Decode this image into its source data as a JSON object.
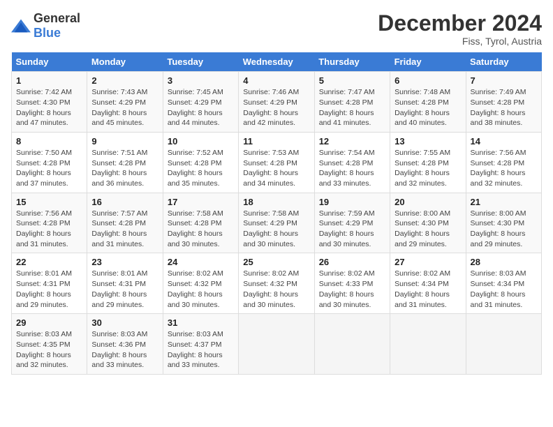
{
  "header": {
    "logo_general": "General",
    "logo_blue": "Blue",
    "title": "December 2024",
    "subtitle": "Fiss, Tyrol, Austria"
  },
  "days_of_week": [
    "Sunday",
    "Monday",
    "Tuesday",
    "Wednesday",
    "Thursday",
    "Friday",
    "Saturday"
  ],
  "weeks": [
    [
      {
        "day": "1",
        "sunrise": "7:42 AM",
        "sunset": "4:30 PM",
        "daylight": "8 hours and 47 minutes."
      },
      {
        "day": "2",
        "sunrise": "7:43 AM",
        "sunset": "4:29 PM",
        "daylight": "8 hours and 45 minutes."
      },
      {
        "day": "3",
        "sunrise": "7:45 AM",
        "sunset": "4:29 PM",
        "daylight": "8 hours and 44 minutes."
      },
      {
        "day": "4",
        "sunrise": "7:46 AM",
        "sunset": "4:29 PM",
        "daylight": "8 hours and 42 minutes."
      },
      {
        "day": "5",
        "sunrise": "7:47 AM",
        "sunset": "4:28 PM",
        "daylight": "8 hours and 41 minutes."
      },
      {
        "day": "6",
        "sunrise": "7:48 AM",
        "sunset": "4:28 PM",
        "daylight": "8 hours and 40 minutes."
      },
      {
        "day": "7",
        "sunrise": "7:49 AM",
        "sunset": "4:28 PM",
        "daylight": "8 hours and 38 minutes."
      }
    ],
    [
      {
        "day": "8",
        "sunrise": "7:50 AM",
        "sunset": "4:28 PM",
        "daylight": "8 hours and 37 minutes."
      },
      {
        "day": "9",
        "sunrise": "7:51 AM",
        "sunset": "4:28 PM",
        "daylight": "8 hours and 36 minutes."
      },
      {
        "day": "10",
        "sunrise": "7:52 AM",
        "sunset": "4:28 PM",
        "daylight": "8 hours and 35 minutes."
      },
      {
        "day": "11",
        "sunrise": "7:53 AM",
        "sunset": "4:28 PM",
        "daylight": "8 hours and 34 minutes."
      },
      {
        "day": "12",
        "sunrise": "7:54 AM",
        "sunset": "4:28 PM",
        "daylight": "8 hours and 33 minutes."
      },
      {
        "day": "13",
        "sunrise": "7:55 AM",
        "sunset": "4:28 PM",
        "daylight": "8 hours and 32 minutes."
      },
      {
        "day": "14",
        "sunrise": "7:56 AM",
        "sunset": "4:28 PM",
        "daylight": "8 hours and 32 minutes."
      }
    ],
    [
      {
        "day": "15",
        "sunrise": "7:56 AM",
        "sunset": "4:28 PM",
        "daylight": "8 hours and 31 minutes."
      },
      {
        "day": "16",
        "sunrise": "7:57 AM",
        "sunset": "4:28 PM",
        "daylight": "8 hours and 31 minutes."
      },
      {
        "day": "17",
        "sunrise": "7:58 AM",
        "sunset": "4:28 PM",
        "daylight": "8 hours and 30 minutes."
      },
      {
        "day": "18",
        "sunrise": "7:58 AM",
        "sunset": "4:29 PM",
        "daylight": "8 hours and 30 minutes."
      },
      {
        "day": "19",
        "sunrise": "7:59 AM",
        "sunset": "4:29 PM",
        "daylight": "8 hours and 30 minutes."
      },
      {
        "day": "20",
        "sunrise": "8:00 AM",
        "sunset": "4:30 PM",
        "daylight": "8 hours and 29 minutes."
      },
      {
        "day": "21",
        "sunrise": "8:00 AM",
        "sunset": "4:30 PM",
        "daylight": "8 hours and 29 minutes."
      }
    ],
    [
      {
        "day": "22",
        "sunrise": "8:01 AM",
        "sunset": "4:31 PM",
        "daylight": "8 hours and 29 minutes."
      },
      {
        "day": "23",
        "sunrise": "8:01 AM",
        "sunset": "4:31 PM",
        "daylight": "8 hours and 29 minutes."
      },
      {
        "day": "24",
        "sunrise": "8:02 AM",
        "sunset": "4:32 PM",
        "daylight": "8 hours and 30 minutes."
      },
      {
        "day": "25",
        "sunrise": "8:02 AM",
        "sunset": "4:32 PM",
        "daylight": "8 hours and 30 minutes."
      },
      {
        "day": "26",
        "sunrise": "8:02 AM",
        "sunset": "4:33 PM",
        "daylight": "8 hours and 30 minutes."
      },
      {
        "day": "27",
        "sunrise": "8:02 AM",
        "sunset": "4:34 PM",
        "daylight": "8 hours and 31 minutes."
      },
      {
        "day": "28",
        "sunrise": "8:03 AM",
        "sunset": "4:34 PM",
        "daylight": "8 hours and 31 minutes."
      }
    ],
    [
      {
        "day": "29",
        "sunrise": "8:03 AM",
        "sunset": "4:35 PM",
        "daylight": "8 hours and 32 minutes."
      },
      {
        "day": "30",
        "sunrise": "8:03 AM",
        "sunset": "4:36 PM",
        "daylight": "8 hours and 33 minutes."
      },
      {
        "day": "31",
        "sunrise": "8:03 AM",
        "sunset": "4:37 PM",
        "daylight": "8 hours and 33 minutes."
      },
      null,
      null,
      null,
      null
    ]
  ],
  "labels": {
    "sunrise_prefix": "Sunrise: ",
    "sunset_prefix": "Sunset: ",
    "daylight_prefix": "Daylight: "
  }
}
